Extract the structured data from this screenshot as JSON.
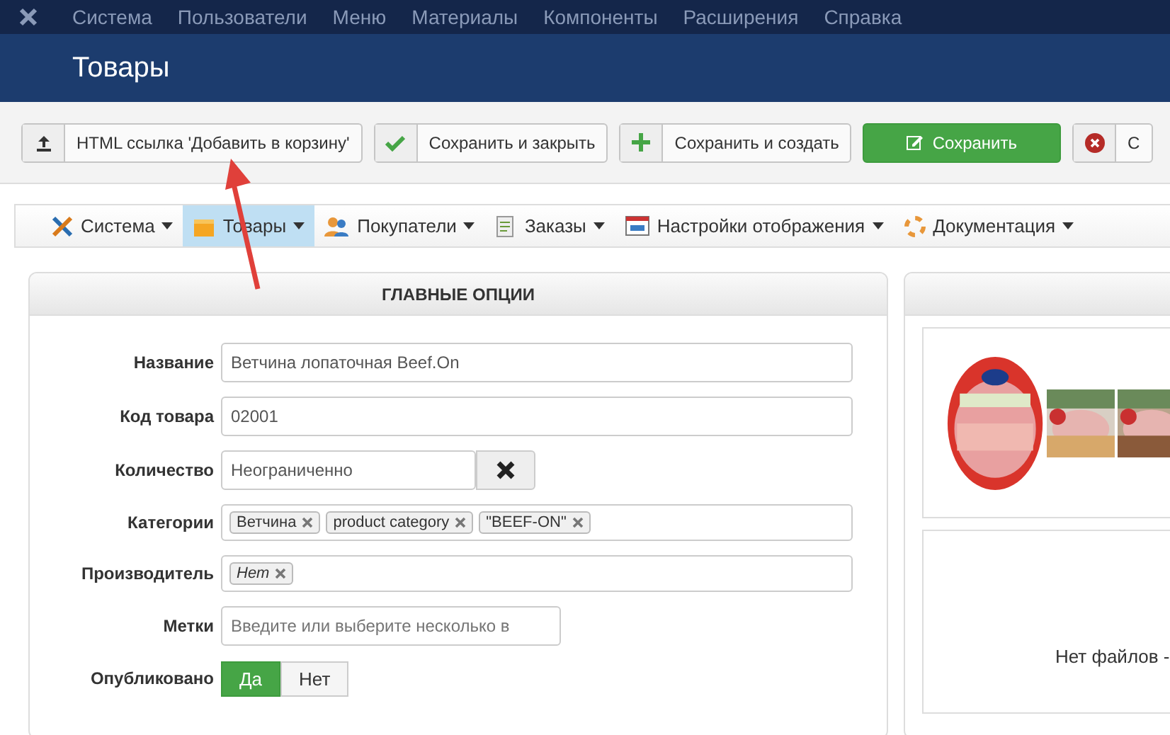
{
  "top_menu": [
    "Система",
    "Пользователи",
    "Меню",
    "Материалы",
    "Компоненты",
    "Расширения",
    "Справка"
  ],
  "page_title": "Товары",
  "toolbar": [
    {
      "kind": "upload",
      "label": "HTML ссылка 'Добавить в корзину'"
    },
    {
      "kind": "check",
      "label": "Сохранить и закрыть"
    },
    {
      "kind": "plus",
      "label": "Сохранить и создать"
    },
    {
      "kind": "primary",
      "label": "Сохранить"
    },
    {
      "kind": "cancel",
      "label": "С"
    }
  ],
  "submenu": [
    {
      "kind": "tools",
      "label": "Система",
      "selected": false
    },
    {
      "kind": "box",
      "label": "Товары",
      "selected": true
    },
    {
      "kind": "users",
      "label": "Покупатели",
      "selected": false
    },
    {
      "kind": "doc",
      "label": "Заказы",
      "selected": false
    },
    {
      "kind": "window",
      "label": "Настройки отображения",
      "selected": false
    },
    {
      "kind": "help",
      "label": "Документация",
      "selected": false
    }
  ],
  "main_options": {
    "title": "ГЛАВНЫЕ ОПЦИИ",
    "fields": [
      {
        "kind": "text",
        "label": "Название",
        "value": "Ветчина лопаточная Beef.On"
      },
      {
        "kind": "text",
        "label": "Код товара",
        "value": "02001"
      },
      {
        "kind": "clear",
        "label": "Количество",
        "value": "Неограниченно"
      },
      {
        "kind": "tags",
        "label": "Категории",
        "tags": [
          "Ветчина",
          "product category",
          "\"BEEF-ON\""
        ]
      },
      {
        "kind": "tags",
        "label": "Производитель",
        "tags": [
          "Нет"
        ],
        "italic": true
      },
      {
        "kind": "placeholder",
        "label": "Метки",
        "placeholder": "Введите или выберите несколько в"
      },
      {
        "kind": "toggle",
        "label": "Опубликовано",
        "options": [
          {
            "label": "Да",
            "selected": true
          },
          {
            "label": "Нет",
            "selected": false
          }
        ]
      }
    ]
  },
  "files_panel": {
    "empty_text": "Нет файлов -"
  },
  "annotation": {
    "kind": "arrow"
  }
}
